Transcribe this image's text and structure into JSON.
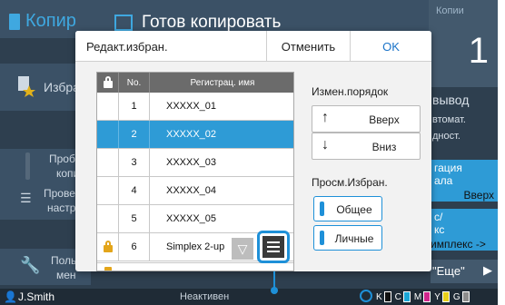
{
  "app": {
    "title": "Копир",
    "status_text": "Готов копировать",
    "copies_label": "Копии",
    "copies_value": "1"
  },
  "sidebar": {
    "favorites": "Избран",
    "proof_line1": "Пробк",
    "proof_line2": "копи",
    "check_line1": "Провер",
    "check_line2": "настро",
    "user_line1": "Польз",
    "user_line2": "мен"
  },
  "background_right": {
    "output": "вывод",
    "auto": "втомат.",
    "density": "дност.",
    "tile1_line1": "гация",
    "tile1_line2": "ала",
    "tile1_line3": "Вверх",
    "tile2_line1": "с/",
    "tile2_line2": "кс",
    "tile2_line3": "имплекс ->",
    "more_label": "\"Еще\""
  },
  "status_bar": {
    "user": "J.Smith",
    "state": "Неактивен",
    "ink": [
      "K",
      "C",
      "M",
      "Y",
      "G"
    ],
    "ink_colors": [
      "#111111",
      "#1aa6d6",
      "#d0268c",
      "#e8cf1a",
      "#8d8d8d"
    ]
  },
  "dialog": {
    "title": "Редакт.избран.",
    "cancel_label": "Отменить",
    "ok_label": "OK",
    "table": {
      "col_no": "No.",
      "col_name": "Регистрац. имя",
      "rows": [
        {
          "no": "1",
          "name": "XXXXX_01",
          "locked": false,
          "selected": false
        },
        {
          "no": "2",
          "name": "XXXXX_02",
          "locked": false,
          "selected": true
        },
        {
          "no": "3",
          "name": "XXXXX_03",
          "locked": false,
          "selected": false
        },
        {
          "no": "4",
          "name": "XXXXX_04",
          "locked": false,
          "selected": false
        },
        {
          "no": "5",
          "name": "XXXXX_05",
          "locked": false,
          "selected": false
        },
        {
          "no": "6",
          "name": "Simplex 2-up",
          "locked": true,
          "selected": false
        }
      ]
    },
    "order": {
      "label": "Измен.порядок",
      "up_label": "Вверх",
      "down_label": "Вниз"
    },
    "view": {
      "label": "Просм.Избран.",
      "common_label": "Общее",
      "personal_label": "Личные",
      "selected": "common"
    }
  },
  "colors": {
    "accent": "#1e90d8",
    "selected_row": "#2e9bd6",
    "screen_bg": "#2e3f4f"
  }
}
